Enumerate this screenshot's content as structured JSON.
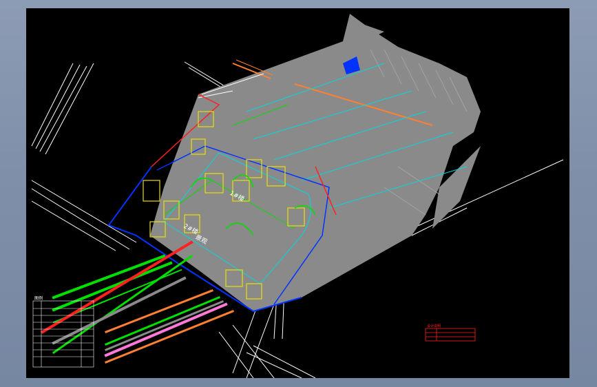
{
  "viewer": {
    "background_color": "#000000",
    "frame_color": "#8497b1"
  },
  "drawing": {
    "title_label": "设计说明",
    "site_labels": [
      "1#楼",
      "2#楼",
      "景观"
    ],
    "legend_table_title": "图例",
    "title_block_rows": [
      "",
      "",
      ""
    ]
  },
  "colors": {
    "building_mass": "#8a8a8a",
    "boundary": "#0033ff",
    "road_line": "#ffffff",
    "green_line": "#00e000",
    "yellow_line": "#e8e000",
    "cyan_line": "#00d8e0",
    "red_line": "#ff2020",
    "orange_line": "#ff8030",
    "pink_line": "#ff7ad8"
  }
}
